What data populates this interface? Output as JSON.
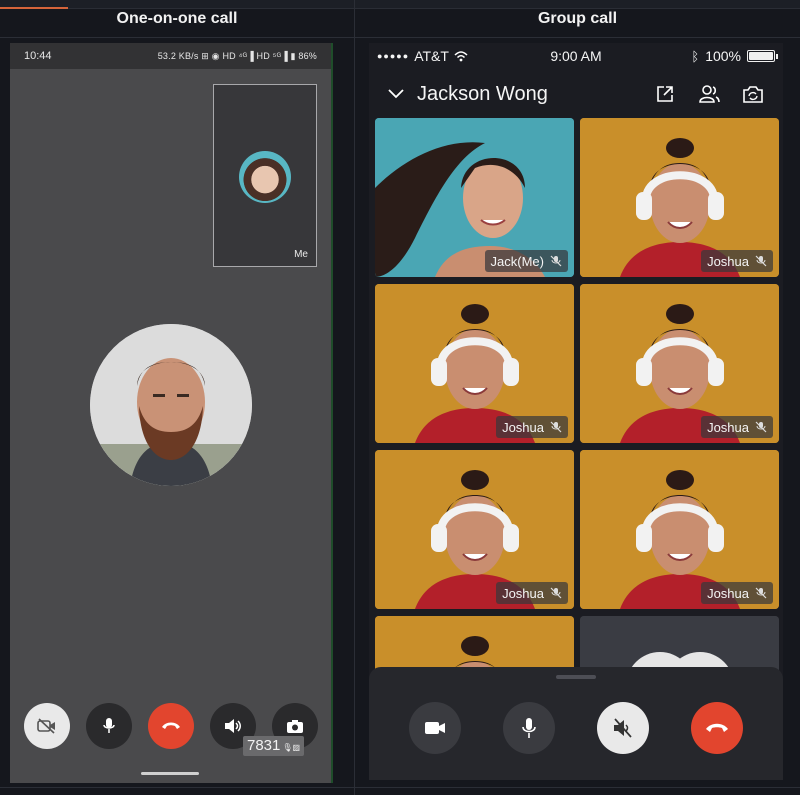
{
  "headers": {
    "left_title": "One-on-one call",
    "right_title": "Group call"
  },
  "one_on_one": {
    "status": {
      "time": "10:44",
      "indicators": "53.2 KB/s ⊞ ◉ HD ⁴ᴳ▐ HD ⁵ᴳ▐ ▮ 86%"
    },
    "self_view_label": "Me",
    "controls": {
      "camera_off": "camera-off-icon",
      "mic": "mic-icon",
      "hang_up": "hangup-icon",
      "speaker": "speaker-icon",
      "switch_camera": "switch-camera-icon"
    },
    "overlay_code": "7831",
    "colors": {
      "hangup": "#e2452e",
      "control_bg": "#2a2a2c",
      "camera_off_bg": "#e9e9e9"
    }
  },
  "group_call": {
    "status": {
      "carrier": "AT&T",
      "time": "9:00 AM",
      "battery": "100%"
    },
    "header": {
      "title": "Jackson Wong"
    },
    "participants": [
      {
        "label": "Jack(Me)",
        "kind": "me"
      },
      {
        "label": "Joshua",
        "kind": "guest"
      },
      {
        "label": "Joshua",
        "kind": "guest"
      },
      {
        "label": "Joshua",
        "kind": "guest"
      },
      {
        "label": "Joshua",
        "kind": "guest"
      },
      {
        "label": "Joshua",
        "kind": "guest"
      },
      {
        "label": "",
        "kind": "guest"
      },
      {
        "label": "",
        "kind": "avatar"
      }
    ],
    "controls": [
      "camera-icon",
      "mic-icon",
      "speaker-muted-icon",
      "hangup-icon"
    ],
    "colors": {
      "hangup": "#e2452e",
      "speaker_muted_bg": "#e9e9e9",
      "control_bg": "#3a3b40",
      "tile_bg": "#c98f2a"
    }
  }
}
